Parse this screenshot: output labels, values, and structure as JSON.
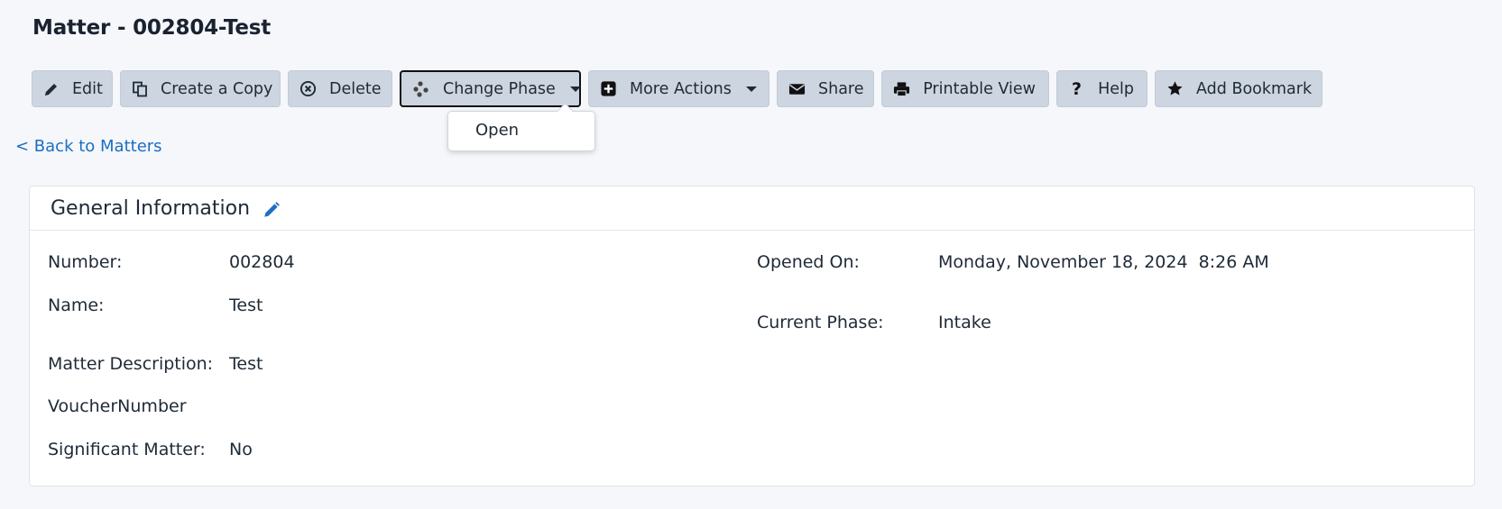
{
  "page": {
    "title": "Matter - 002804-Test"
  },
  "toolbar": {
    "edit": "Edit",
    "create_copy": "Create a Copy",
    "delete": "Delete",
    "change_phase": "Change Phase",
    "more_actions": "More Actions",
    "share": "Share",
    "printable_view": "Printable View",
    "help": "Help",
    "add_bookmark": "Add Bookmark"
  },
  "change_phase_menu": {
    "items": [
      "Open"
    ]
  },
  "nav": {
    "back_link": "< Back to Matters"
  },
  "general_info": {
    "title": "General Information",
    "left": {
      "number_label": "Number:",
      "number_value": "002804",
      "name_label": "Name:",
      "name_value": "Test",
      "description_label": "Matter Description:",
      "description_value": "Test",
      "voucher_label": "VoucherNumber",
      "significant_label": "Significant Matter:",
      "significant_value": "No"
    },
    "right": {
      "opened_label": "Opened On:",
      "opened_value": "Monday, November 18, 2024  8:26 AM",
      "phase_label": "Current Phase:",
      "phase_value": "Intake"
    }
  },
  "colors": {
    "link": "#1a6fc2",
    "button_bg": "#ccd5e0",
    "page_bg": "#f5f7fa"
  },
  "icons": {
    "edit": "pencil-icon",
    "copy": "copy-icon",
    "delete": "circle-x-icon",
    "phase": "nodes-icon",
    "more": "plus-square-icon",
    "share": "envelope-icon",
    "print": "printer-icon",
    "help": "question-icon",
    "bookmark": "star-icon",
    "section_edit": "pencil-icon"
  }
}
